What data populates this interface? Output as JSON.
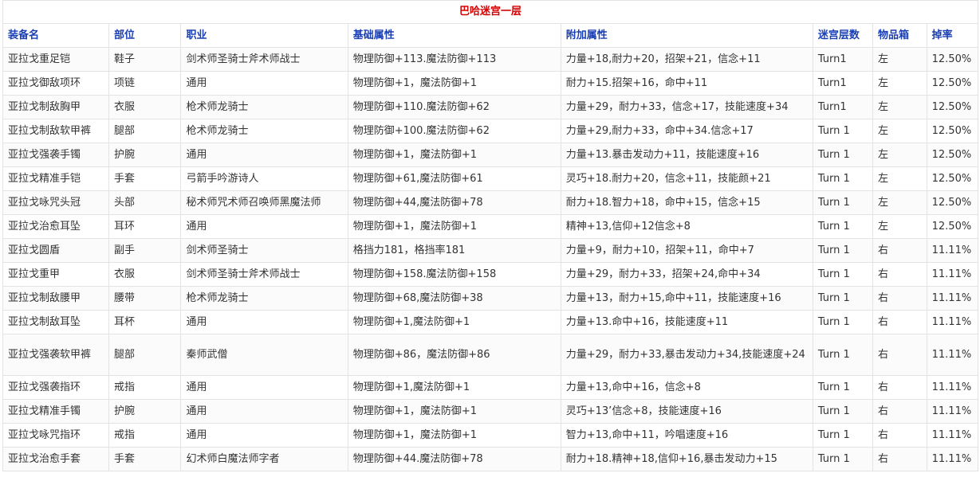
{
  "page": {
    "title": "巴哈迷宫一层"
  },
  "table": {
    "headers": [
      "装备名",
      "部位",
      "职业",
      "基础属性",
      "附加属性",
      "迷宫层数",
      "物品箱",
      "掉率"
    ],
    "rows": [
      [
        "亚拉戈重足铠",
        "鞋子",
        "剑术师圣骑士斧术师战士",
        "物理防御+113.魔法防御+113",
        "力量+18,耐力+20，招架+21，信念+11",
        "Turn1",
        "左",
        "12.50%"
      ],
      [
        "亚拉戈御敌项环",
        "项链",
        "通用",
        "物理防御+1，魔法防御+1",
        "耐力+15.招架+16，命中+11",
        "Turn1",
        "左",
        "12.50%"
      ],
      [
        "亚拉戈制敌胸甲",
        "衣服",
        "枪术师龙骑士",
        "物理防御+110.魔法防御+62",
        "力量+29，耐力+33，信念+17，技能速度+34",
        "Turn1",
        "左",
        "12.50%"
      ],
      [
        "亚拉戈制敌软甲裤",
        "腿部",
        "枪术师龙骑士",
        "物理防御+100.魔法防御+62",
        "力量+29,耐力+33，命中+34.信念+17",
        "Turn 1",
        "左",
        "12.50%"
      ],
      [
        "亚拉戈强袭手镯",
        "护腕",
        "通用",
        "物理防御+1，魔法防御+1",
        "力量+13.暴击发动力+11，技能速度+16",
        "Turn 1",
        "左",
        "12.50%"
      ],
      [
        "亚拉戈精准手铠",
        "手套",
        "弓箭手吟游诗人",
        "物理防御+61,魔法防御+61",
        "灵巧+18.耐力+20，信念+11，技能颜+21",
        "Turn 1",
        "左",
        "12.50%"
      ],
      [
        "亚拉戈咏咒头冠",
        "头部",
        "秘术师咒术师召唤师黑魔法师",
        "物理防御+44,魔法防御+78",
        "耐力+18.智力+18，命中+15，信念+15",
        "Turn 1",
        "左",
        "12.50%"
      ],
      [
        "亚拉戈治愈耳坠",
        "耳环",
        "通用",
        "物理防御+1，魔法防御+1",
        "精神+13,信仰+12信念+8",
        "Turn 1",
        "左",
        "12.50%"
      ],
      [
        "亚拉戈圆盾",
        "副手",
        "剑术师圣骑士",
        "格挡力181，格挡率181",
        "力量+9，耐力+10，招架+11，命中+7",
        "Turn 1",
        "右",
        "11.11%"
      ],
      [
        "亚拉戈重甲",
        "衣服",
        "剑术师圣骑士斧术师战士",
        "物理防御+158.魔法防御+158",
        "力量+29，耐力+33，招架+24,命中+34",
        "Turn 1",
        "右",
        "11.11%"
      ],
      [
        "亚拉戈制敌腰甲",
        "腰带",
        "枪术师龙骑士",
        "物理防御+68,魔法防御+38",
        "力量+13，耐力+15,命中+11，技能速度+16",
        "Turn 1",
        "右",
        "11.11%"
      ],
      [
        "亚拉戈制敌耳坠",
        "耳杯",
        "通用",
        "物理防御+1,魔法防御+1",
        "力量+13.命中+16，技能速度+11",
        "Turn 1",
        "右",
        "11.11%"
      ],
      [
        "亚拉戈强袭软甲裤",
        "腿部",
        "秦师武僧",
        "物理防御+86，魔法防御+86",
        "力量+29，耐力+33,暴击发动力+34,技能速度+24",
        "Turn 1",
        "右",
        "11.11%"
      ],
      [
        "亚拉戈强袭指环",
        "戒指",
        "通用",
        "物理防御+1,魔法防御+1",
        "力量+13,命中+16，信念+8",
        "Turn 1",
        "右",
        "11.11%"
      ],
      [
        "亚拉戈精准手镯",
        "护腕",
        "通用",
        "物理防御+1，魔法防御+1",
        "灵巧+13’信念+8，技能速度+16",
        "Turn 1",
        "右",
        "11.11%"
      ],
      [
        "亚拉戈咏咒指环",
        "戒指",
        "通用",
        "物理防御+1，魔法防御+1",
        "智力+13,命中+11，吟唱速度+16",
        "Turn 1",
        "右",
        "11.11%"
      ],
      [
        "亚拉戈治愈手套",
        "手套",
        "幻术师白魔法师字者",
        "物理防御+44.魔法防御+78",
        "耐力+18.精神+18,信仰+16,暴击发动力+15",
        "Turn 1",
        "右",
        "11.11%"
      ]
    ]
  }
}
